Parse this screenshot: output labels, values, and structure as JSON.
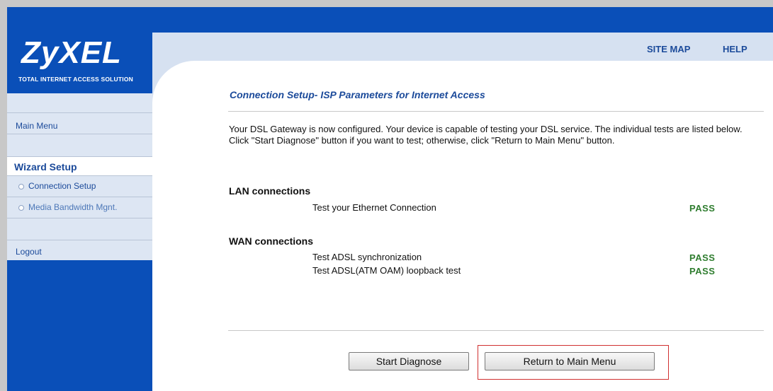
{
  "brand": {
    "logo_text": "ZyXEL",
    "tagline": "TOTAL INTERNET ACCESS SOLUTION"
  },
  "header": {
    "site_map": "SITE MAP",
    "help": "HELP"
  },
  "sidebar": {
    "main_menu": "Main Menu",
    "section": "Wizard Setup",
    "items": [
      {
        "label": "Connection Setup",
        "state": "active"
      },
      {
        "label": "Media Bandwidth Mgnt.",
        "state": "inactive"
      }
    ],
    "logout": "Logout"
  },
  "main": {
    "title": "Connection Setup- ISP Parameters for Internet Access",
    "description": "Your DSL Gateway is now configured. Your device is capable of testing your DSL service. The individual tests are listed below. Click \"Start Diagnose\" button if you want to test; otherwise, click \"Return to Main Menu\" button.",
    "lan": {
      "heading": "LAN connections",
      "tests": [
        {
          "name": "Test your Ethernet Connection",
          "result": "PASS"
        }
      ]
    },
    "wan": {
      "heading": "WAN connections",
      "tests": [
        {
          "name": "Test ADSL synchronization",
          "result": "PASS"
        },
        {
          "name": "Test ADSL(ATM OAM) loopback test",
          "result": "PASS"
        }
      ]
    },
    "buttons": {
      "start": "Start Diagnose",
      "return": "Return to Main Menu"
    }
  },
  "colors": {
    "brand_blue": "#0a4fb8",
    "pass_green": "#2f7d2f",
    "highlight_red": "#d03030"
  }
}
